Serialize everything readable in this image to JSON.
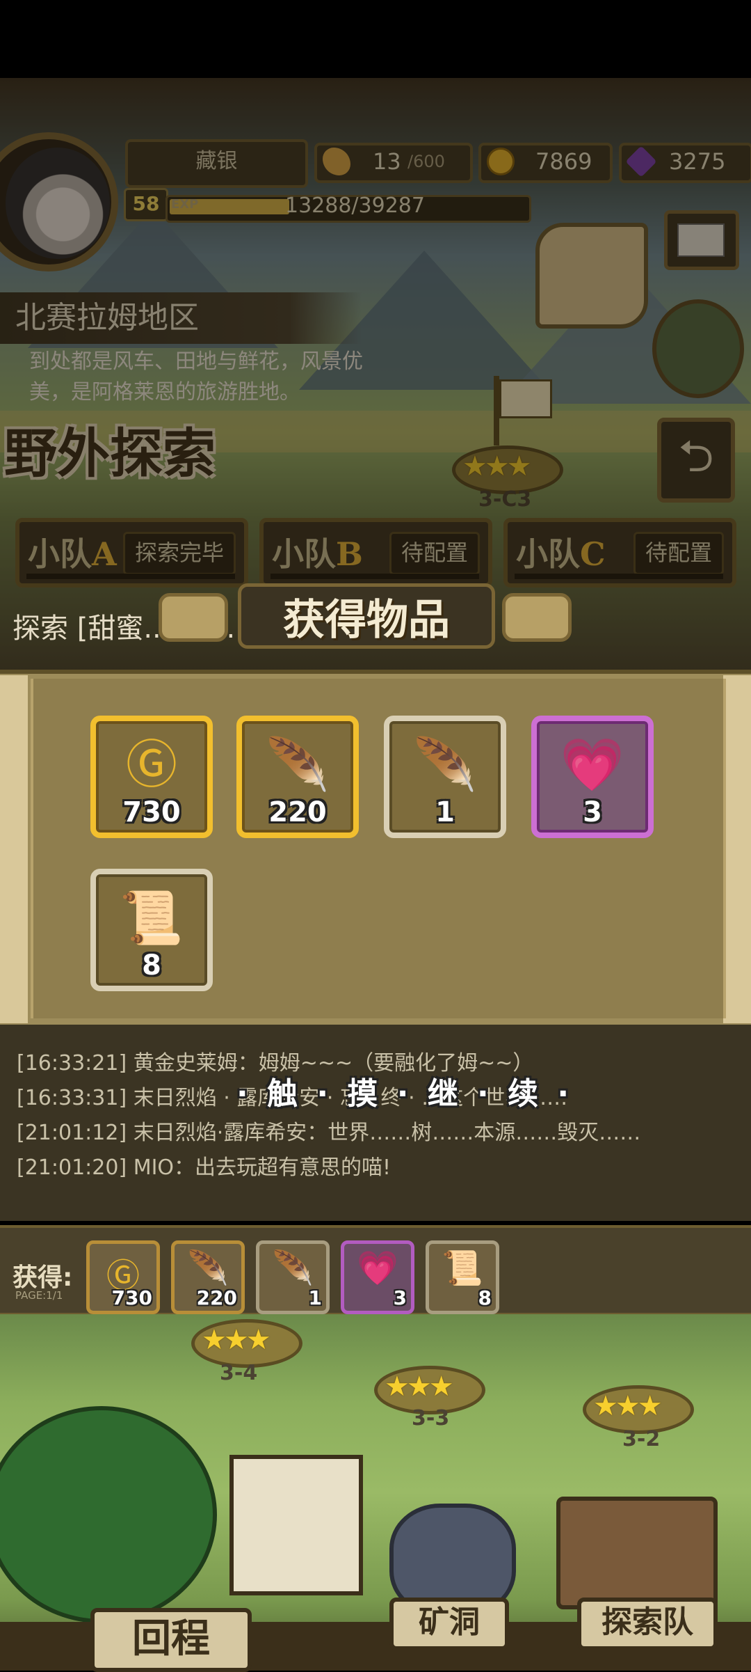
{
  "player": {
    "name": "藏银",
    "level": "58",
    "exp_label": "EXP",
    "exp_text": "13288/39287",
    "exp_current": 13288,
    "exp_max": 39287
  },
  "resources": {
    "stamina_current": "13",
    "stamina_max": "/600",
    "gold": "7869",
    "gems": "3275"
  },
  "region": {
    "name": "北赛拉姆地区",
    "description": "到处都是风车、田地与鲜花，风景优美，是阿格莱恩的旅游胜地。"
  },
  "page_title": "野外探索",
  "map_nodes": {
    "top": "3-C3",
    "node_34": "3-4",
    "node_33": "3-3",
    "node_32": "3-2",
    "stars": "★★★"
  },
  "teams": [
    {
      "label": "小队",
      "letter": "A",
      "status": "探索完毕"
    },
    {
      "label": "小队",
      "letter": "B",
      "status": "待配置"
    },
    {
      "label": "小队",
      "letter": "C",
      "status": "待配置"
    }
  ],
  "explore_line": "探索 [甜蜜...路] ...",
  "popup": {
    "title": "获得物品",
    "continue_hint": "· 触 · 摸 · 继 · 续 ·"
  },
  "items": [
    {
      "name": "gold-coin",
      "count": "730",
      "rarity": "gold",
      "glyph": "Ⓖ"
    },
    {
      "name": "green-feather",
      "count": "220",
      "rarity": "gold",
      "glyph": "🪶"
    },
    {
      "name": "rainbow-feather",
      "count": "1",
      "rarity": "plain",
      "glyph": "🪶"
    },
    {
      "name": "winged-heart",
      "count": "3",
      "rarity": "purple",
      "glyph": "💗"
    },
    {
      "name": "scroll",
      "count": "8",
      "rarity": "plain",
      "glyph": "📜"
    }
  ],
  "log": [
    {
      "time": "[16:33:21]",
      "text": "黄金史莱姆：姆姆~~~（要融化了姆~~）"
    },
    {
      "time": "[16:33:31]",
      "text": "末日烈焰 · 露库希安 · 忘 · 终 · …这个世界……"
    },
    {
      "time": "[21:01:12]",
      "text": "末日烈焰·露库希安：世界……树……本源……毁灭……"
    },
    {
      "time": "[21:01:20]",
      "text": "MIO：出去玩超有意思的喵!"
    }
  ],
  "obtain": {
    "label": "获得:",
    "page": "PAGE:1/1",
    "items": [
      "730",
      "220",
      "1",
      "3",
      "8"
    ]
  },
  "bottom_nav": {
    "return": "回程",
    "mine": "矿洞",
    "team": "探索队"
  }
}
